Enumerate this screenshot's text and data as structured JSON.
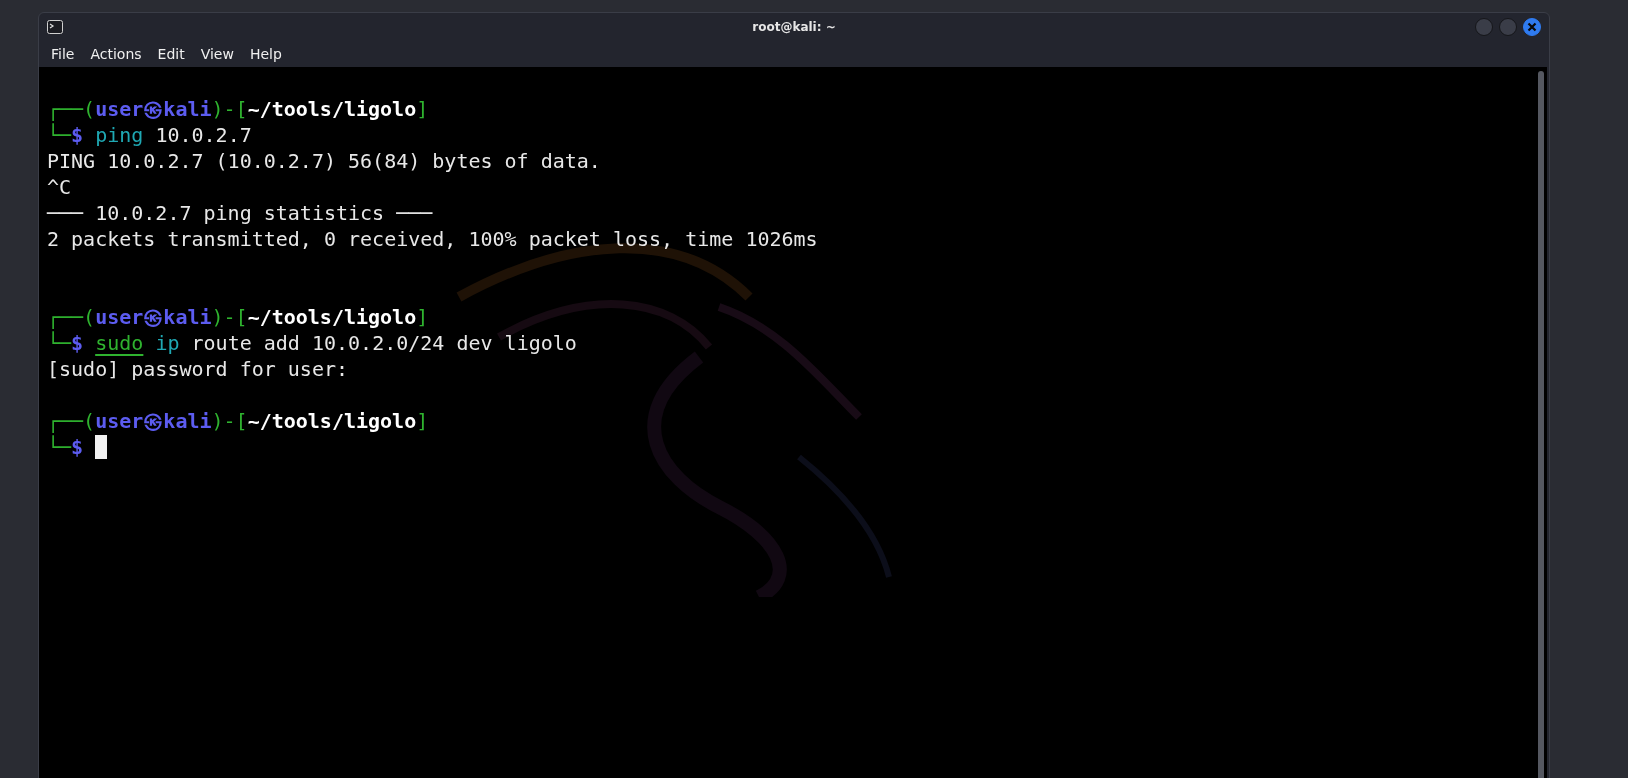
{
  "window": {
    "title": "root@kali: ~"
  },
  "menu": [
    "File",
    "Actions",
    "Edit",
    "View",
    "Help"
  ],
  "terminal": {
    "lines": [
      {
        "segments": [
          {
            "kind": "frame",
            "text": "┌──("
          },
          {
            "kind": "user",
            "text": "user㉿kali"
          },
          {
            "kind": "frame",
            "text": ")-["
          },
          {
            "kind": "path",
            "text": "~/tools/ligolo"
          },
          {
            "kind": "frame",
            "text": "]"
          }
        ]
      },
      {
        "segments": [
          {
            "kind": "frame",
            "text": "└─"
          },
          {
            "kind": "dollar",
            "text": "$ "
          },
          {
            "kind": "program",
            "text": "ping"
          },
          {
            "kind": "plain",
            "text": " 10.0.2.7"
          }
        ]
      },
      {
        "segments": [
          {
            "kind": "plain",
            "text": "PING 10.0.2.7 (10.0.2.7) 56(84) bytes of data."
          }
        ]
      },
      {
        "segments": [
          {
            "kind": "plain",
            "text": "^C"
          }
        ]
      },
      {
        "segments": [
          {
            "kind": "plain",
            "text": "─── 10.0.2.7 ping statistics ───"
          }
        ]
      },
      {
        "segments": [
          {
            "kind": "plain",
            "text": "2 packets transmitted, 0 received, 100% packet loss, time 1026ms"
          }
        ]
      },
      {
        "kind": "blank"
      },
      {
        "kind": "blank"
      },
      {
        "segments": [
          {
            "kind": "frame",
            "text": "┌──("
          },
          {
            "kind": "user",
            "text": "user㉿kali"
          },
          {
            "kind": "frame",
            "text": ")-["
          },
          {
            "kind": "path",
            "text": "~/tools/ligolo"
          },
          {
            "kind": "frame",
            "text": "]"
          }
        ]
      },
      {
        "segments": [
          {
            "kind": "frame",
            "text": "└─"
          },
          {
            "kind": "dollar",
            "text": "$ "
          },
          {
            "kind": "sudo",
            "text": "sudo"
          },
          {
            "kind": "program",
            "text": " ip"
          },
          {
            "kind": "plain",
            "text": " route add 10.0.2.0/24 dev ligolo"
          }
        ]
      },
      {
        "segments": [
          {
            "kind": "plain",
            "text": "[sudo] password for user:"
          }
        ]
      },
      {
        "kind": "blank"
      },
      {
        "segments": [
          {
            "kind": "frame",
            "text": "┌──("
          },
          {
            "kind": "user",
            "text": "user㉿kali"
          },
          {
            "kind": "frame",
            "text": ")-["
          },
          {
            "kind": "path",
            "text": "~/tools/ligolo"
          },
          {
            "kind": "frame",
            "text": "]"
          }
        ]
      },
      {
        "cursor": true,
        "segments": [
          {
            "kind": "frame",
            "text": "└─"
          },
          {
            "kind": "dollar",
            "text": "$ "
          }
        ]
      }
    ]
  }
}
